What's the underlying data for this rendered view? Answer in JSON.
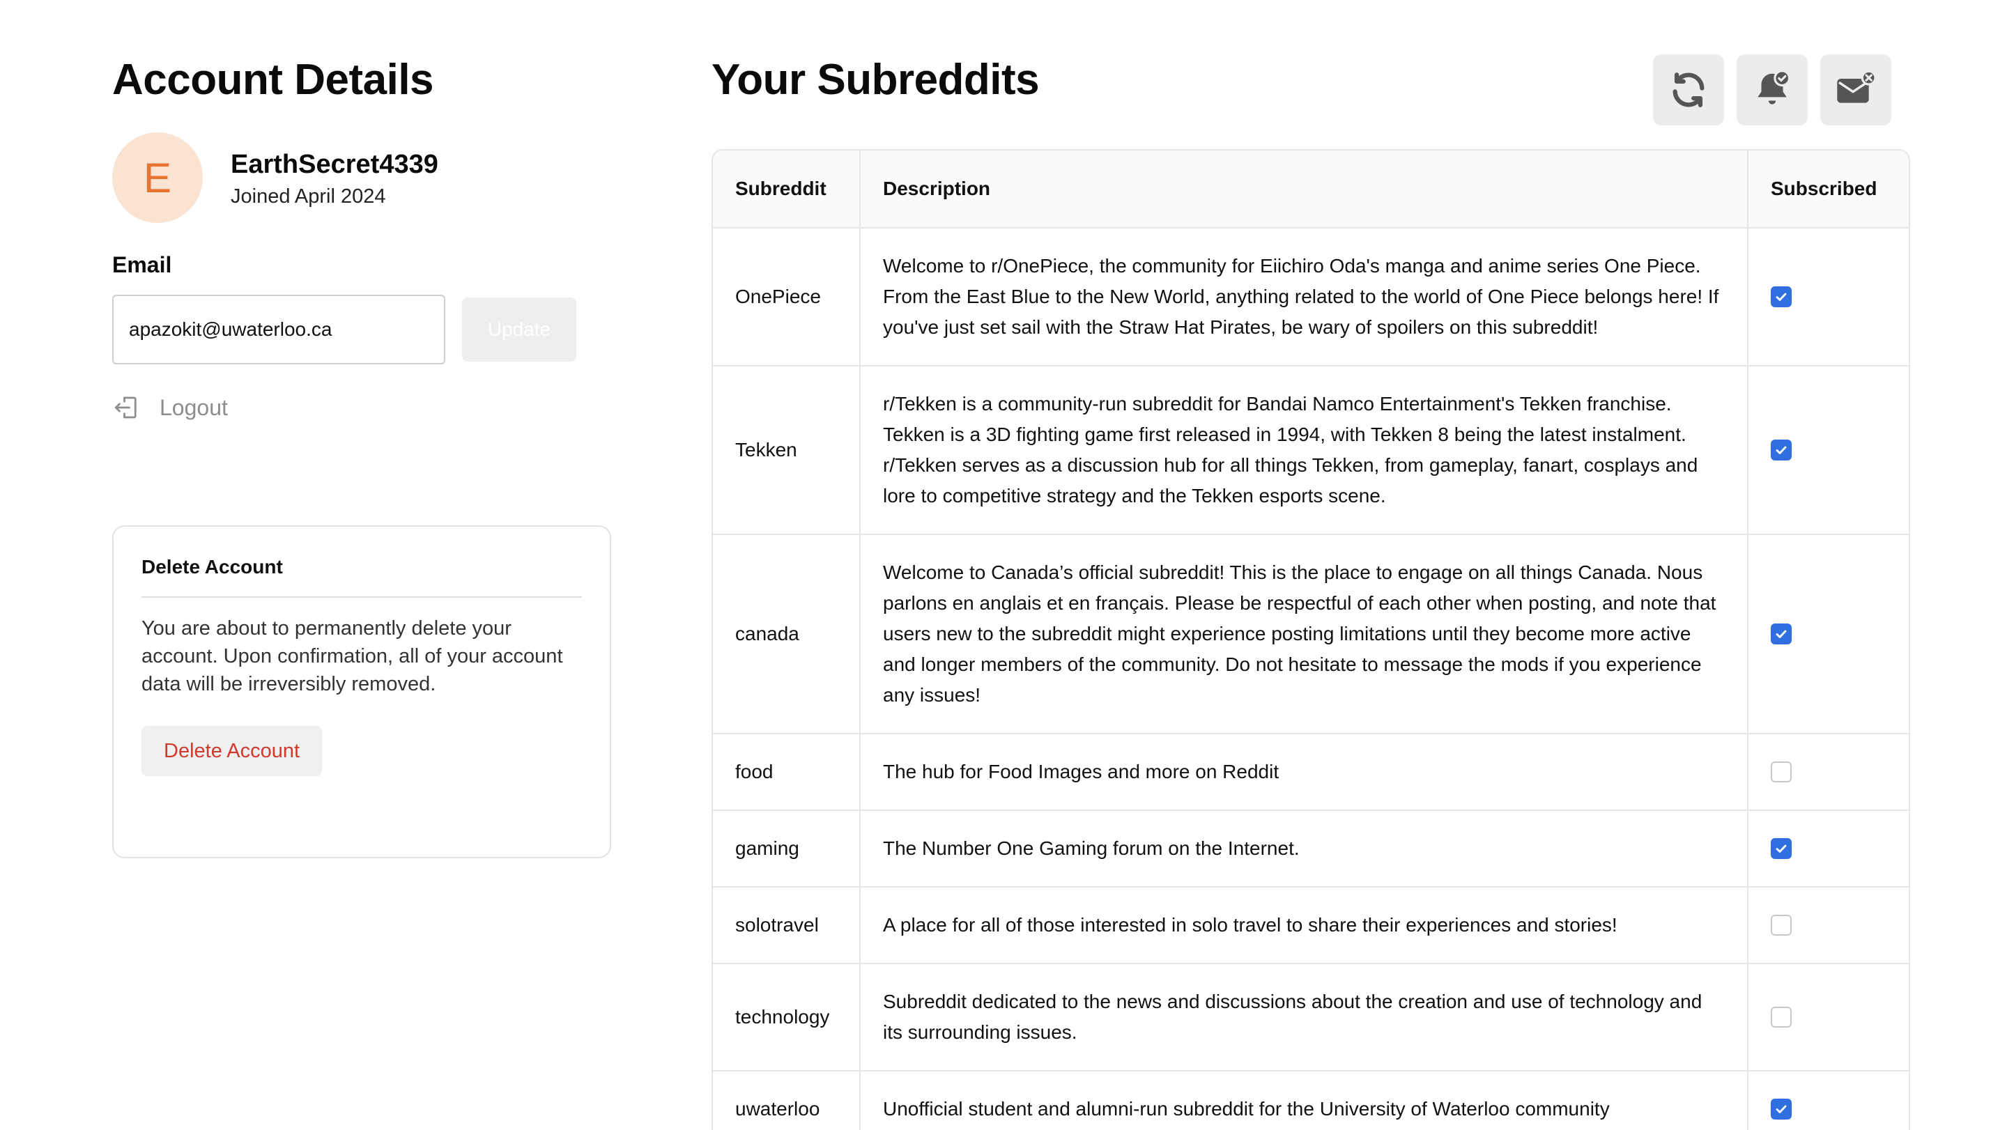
{
  "account": {
    "title": "Account Details",
    "avatar_letter": "E",
    "username": "EarthSecret4339",
    "joined": "Joined April 2024",
    "email_label": "Email",
    "email_value": "apazokit@uwaterloo.ca",
    "update_label": "Update",
    "logout_label": "Logout"
  },
  "delete_card": {
    "title": "Delete Account",
    "text": "You are about to permanently delete your account. Upon confirmation, all of your account data will be irreversibly removed.",
    "button_label": "Delete Account"
  },
  "subreddits": {
    "title": "Your Subreddits",
    "toolbar": [
      "refresh-icon",
      "bell-check-icon",
      "mail-x-icon"
    ],
    "columns": [
      "Subreddit",
      "Description",
      "Subscribed"
    ],
    "rows": [
      {
        "name": "OnePiece",
        "description": "Welcome to r/OnePiece, the community for Eiichiro Oda's manga and anime series One Piece. From the East Blue to the New World, anything related to the world of One Piece belongs here! If you've just set sail with the Straw Hat Pirates, be wary of spoilers on this subreddit!",
        "subscribed": true
      },
      {
        "name": "Tekken",
        "description": "r/Tekken is a community-run subreddit for Bandai Namco Entertainment's Tekken franchise. Tekken is a 3D fighting game first released in 1994, with Tekken 8 being the latest instalment. r/Tekken serves as a discussion hub for all things Tekken, from gameplay, fanart, cosplays and lore to competitive strategy and the Tekken esports scene.",
        "subscribed": true
      },
      {
        "name": "canada",
        "description": "Welcome to Canada’s official subreddit! This is the place to engage on all things Canada. Nous parlons en anglais et en français. Please be respectful of each other when posting, and note that users new to the subreddit might experience posting limitations until they become more active and longer members of the community. Do not hesitate to message the mods if you experience any issues!",
        "subscribed": true
      },
      {
        "name": "food",
        "description": "The hub for Food Images and more on Reddit",
        "subscribed": false
      },
      {
        "name": "gaming",
        "description": "The Number One Gaming forum on the Internet.",
        "subscribed": true
      },
      {
        "name": "solotravel",
        "description": "A place for all of those interested in solo travel to share their experiences and stories!",
        "subscribed": false
      },
      {
        "name": "technology",
        "description": "Subreddit dedicated to the news and discussions about the creation and use of technology and its surrounding issues.",
        "subscribed": false
      },
      {
        "name": "uwaterloo",
        "description": "Unofficial student and alumni-run subreddit for the University of Waterloo community",
        "subscribed": true
      }
    ]
  },
  "colors": {
    "accent": "#2f6fe0",
    "avatar_bg": "#fbe3d2",
    "avatar_fg": "#e8742f",
    "danger": "#cf3a2c"
  }
}
